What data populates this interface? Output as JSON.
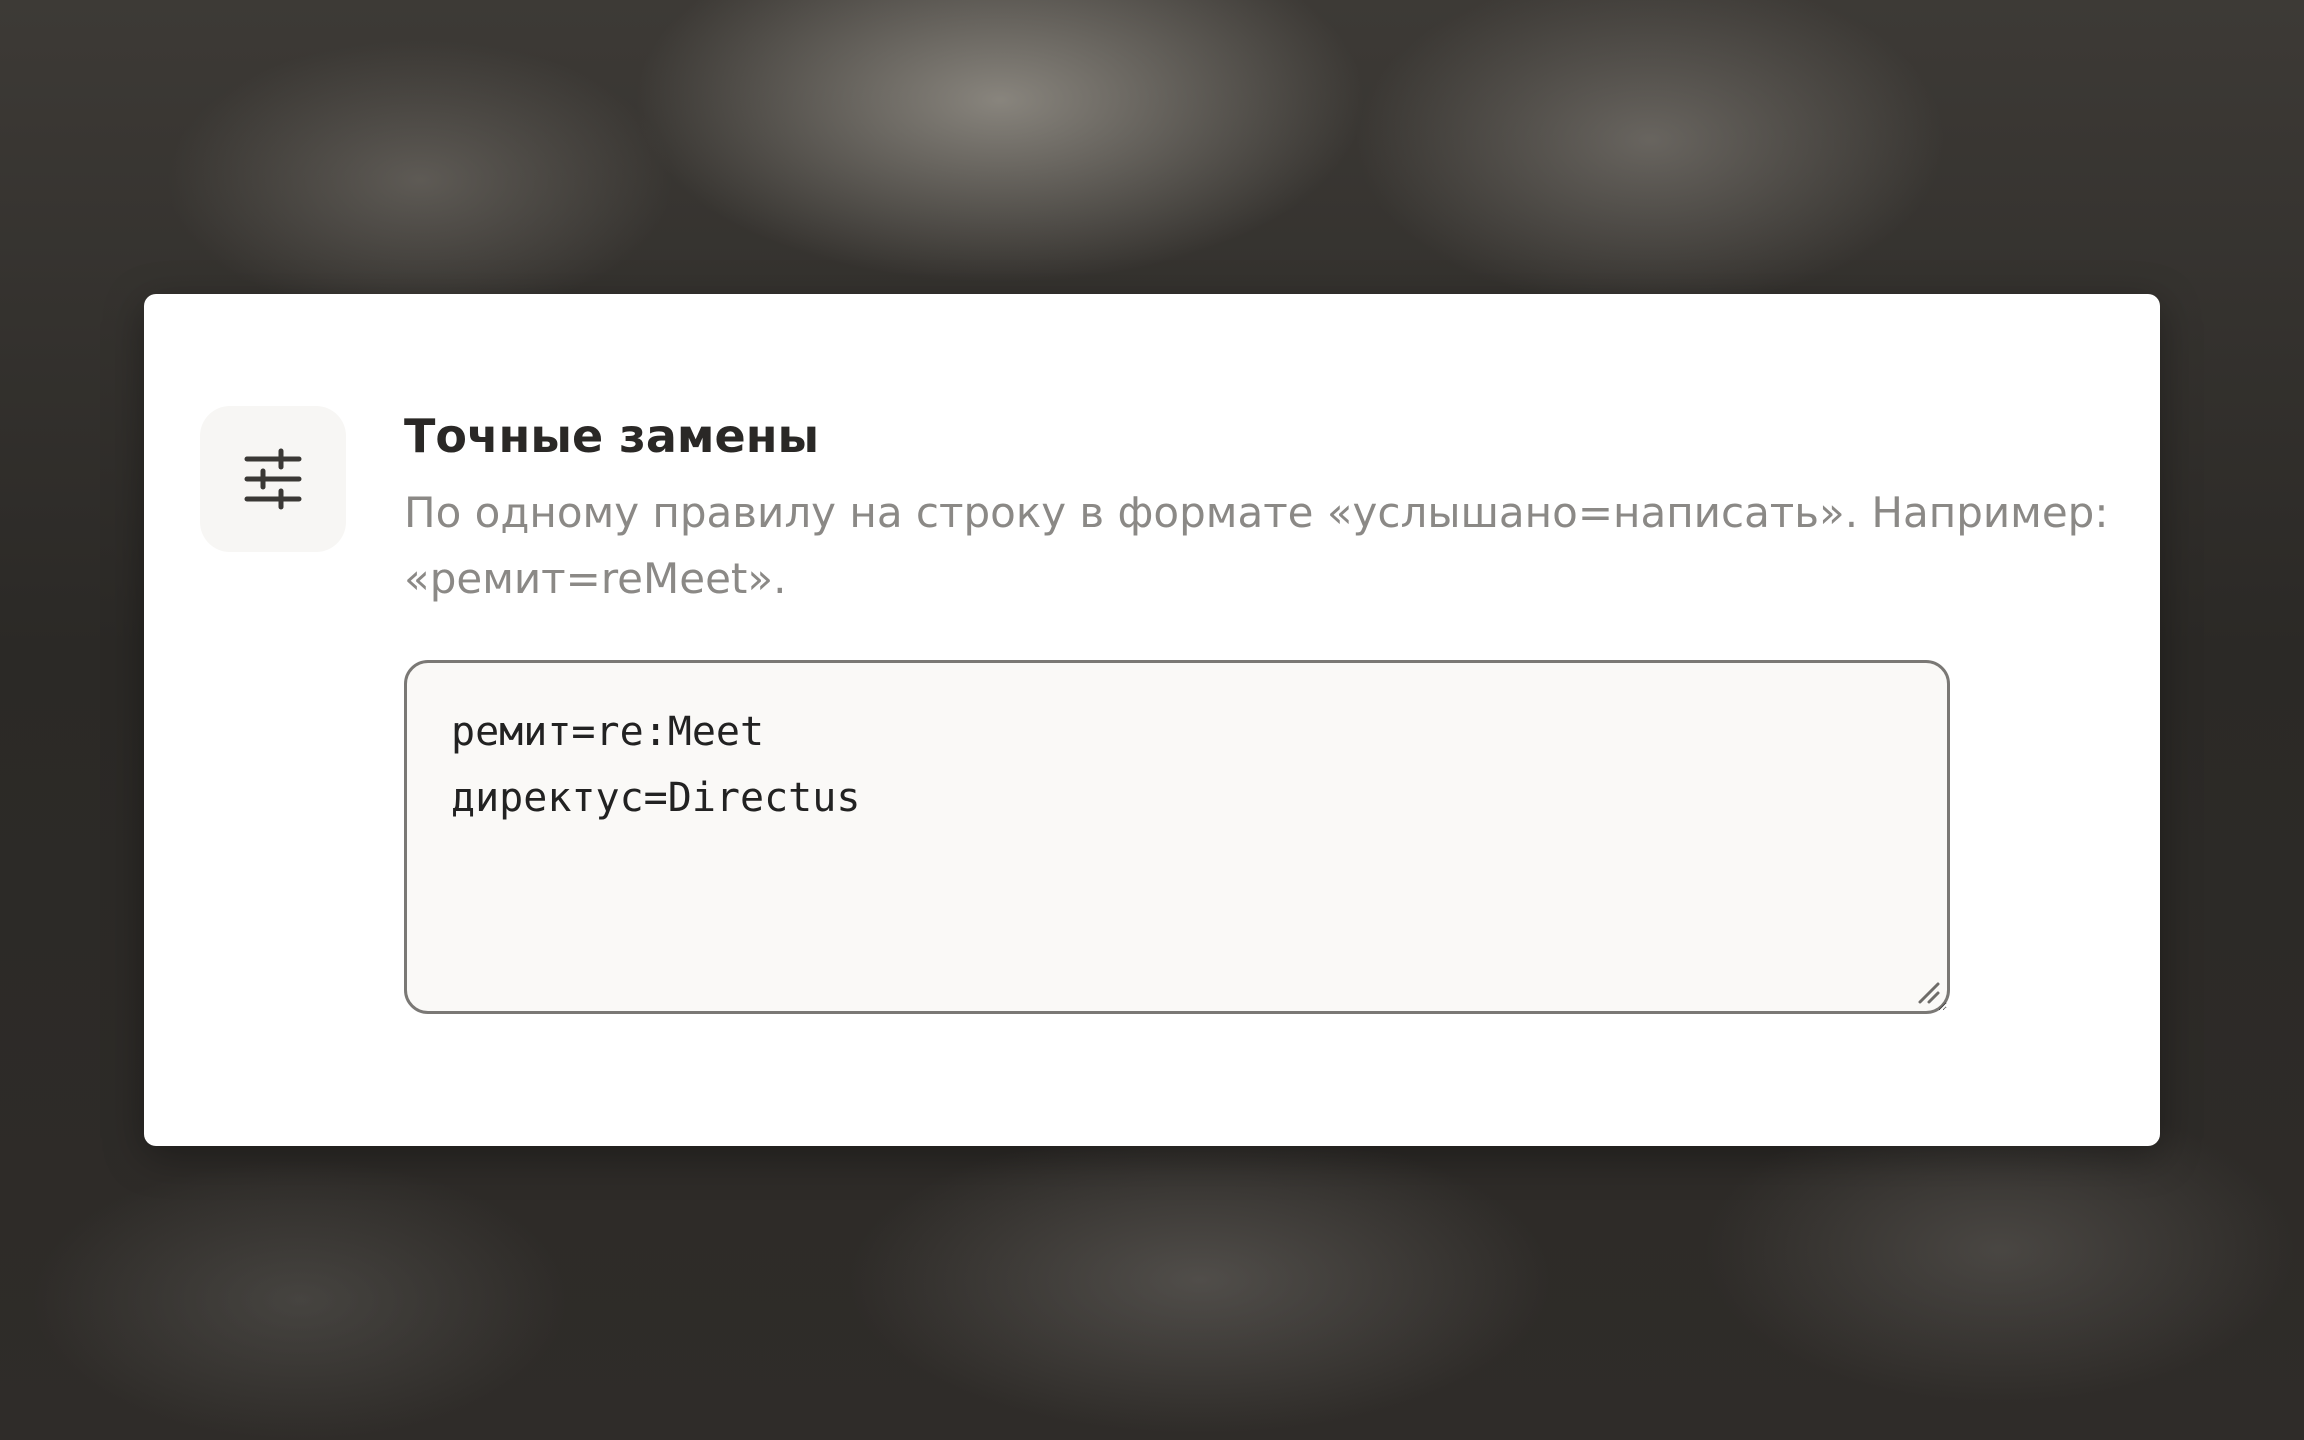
{
  "setting": {
    "icon": "sliders-icon",
    "title": "Точные замены",
    "description": "По одному правилу на строку в формате «услышано=написать». Например: «ремит=reMeet».",
    "rules_value": "ремит=re:Meet\nдиректус=Directus"
  },
  "colors": {
    "card_background": "#ffffff",
    "icon_box_background": "#f7f6f4",
    "title": "#2a2826",
    "description": "#8b8986",
    "textarea_border": "#7a7875"
  }
}
